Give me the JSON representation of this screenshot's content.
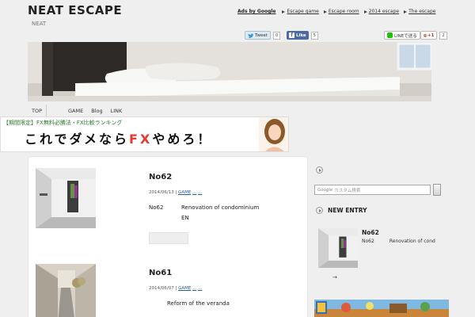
{
  "site": {
    "title": "NEAT ESCAPE",
    "description": "NEAT"
  },
  "header_ads": {
    "label": "Ads by Google",
    "links": [
      "Escape game",
      "Escape room",
      "2014 escape",
      "The escape"
    ]
  },
  "share": {
    "twitter": {
      "label": "Tweet",
      "count": "0"
    },
    "facebook": {
      "label": "Like",
      "count": "5"
    },
    "line": {
      "label": "LINEで送る"
    },
    "google_plus": {
      "label": "+1",
      "count": "2"
    }
  },
  "nav": {
    "items": [
      "TOP",
      "GAME",
      "Blog",
      "LINK"
    ]
  },
  "banner": {
    "top_text": "【期間限定】FX無料必勝法・FX比較ランキング",
    "main_text_pre": "これでダメなら",
    "main_text_fx": "FX",
    "main_text_post": "やめろ！"
  },
  "posts": [
    {
      "title": "No62",
      "date": "2014/06/13",
      "category": "GAME",
      "extra_link_1": "...",
      "extra_link_2": "...",
      "name": "No62",
      "description": "Renovation of condominium",
      "lang": "EN"
    },
    {
      "title": "No61",
      "date": "2014/06/07",
      "category": "GAME",
      "extra_link_1": "...",
      "extra_link_2": "...",
      "description": "Reform of the veranda"
    }
  ],
  "sidebar": {
    "search_brand": "Google",
    "search_placeholder": "カスタム検索",
    "new_entry_heading": "NEW ENTRY",
    "new_entry": {
      "title": "No62",
      "text": "No62          Renovation of cond"
    },
    "arrow": "→"
  },
  "colors": {
    "facebook": "#4d69a2",
    "line_green": "#1fc200",
    "link_blue": "#2a5db0",
    "fx_red": "#e53935"
  }
}
